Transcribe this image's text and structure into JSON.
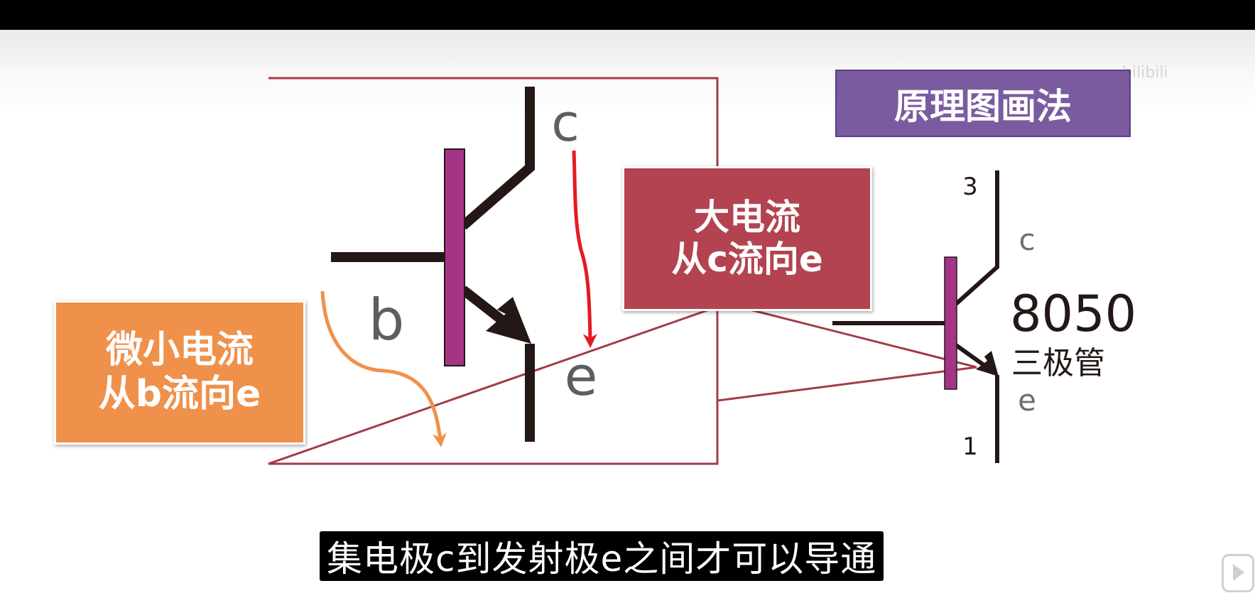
{
  "title": "原理图画法",
  "callout_small_current": {
    "line1": "微小电流",
    "line2": "从b流向e"
  },
  "callout_large_current": {
    "line1": "大电流",
    "line2": "从c流向e"
  },
  "big_diagram": {
    "collector": "c",
    "base": "b",
    "emitter": "e"
  },
  "small_diagram": {
    "pin_top": "3",
    "pin_bottom": "1",
    "collector": "c",
    "emitter": "e",
    "part_number": "8050",
    "part_type": "三极管"
  },
  "subtitle": "集电极c到发射极e之间才可以导通",
  "watermark": "bilibili",
  "colors": {
    "box_outline": "#a43a48",
    "bar_purple": "#a53487",
    "arrow_red": "#e31b23",
    "arrow_orange": "#ef914b",
    "title_purple": "#7b5ba0"
  }
}
